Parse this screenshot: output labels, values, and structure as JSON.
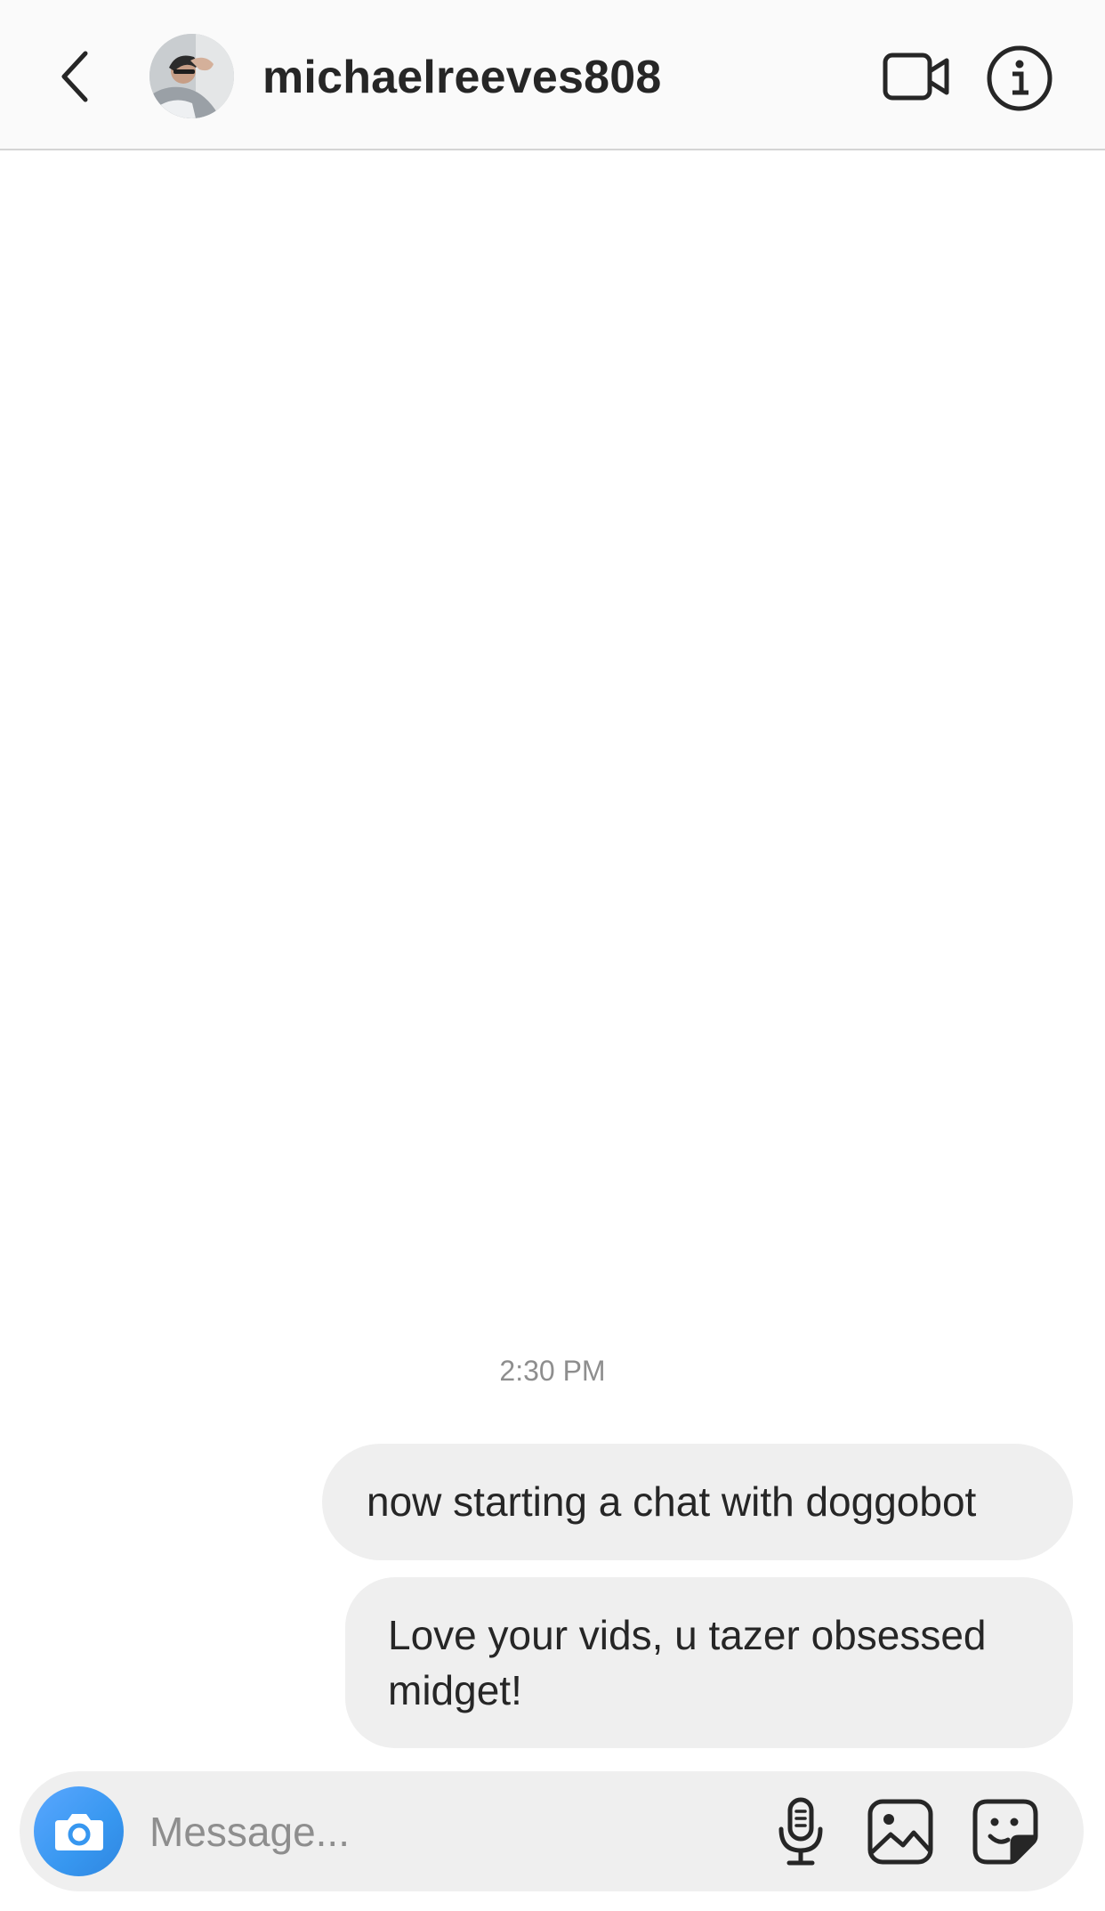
{
  "header": {
    "username": "michaelreeves808",
    "icons": {
      "back": "chevron-left-icon",
      "video": "video-camera-icon",
      "info": "info-icon"
    }
  },
  "thread": {
    "timestamp": "2:30 PM",
    "messages": [
      {
        "from": "me",
        "text": "now starting a chat with doggobot"
      },
      {
        "from": "me",
        "text": "Love your vids, u tazer obsessed midget!"
      }
    ]
  },
  "composer": {
    "placeholder": "Message...",
    "value": "",
    "icons": {
      "camera": "camera-icon",
      "mic": "microphone-icon",
      "gallery": "image-icon",
      "sticker": "sticker-icon"
    }
  },
  "colors": {
    "header_bg": "#fafafa",
    "bubble_bg": "#efefef",
    "text": "#262626",
    "muted": "#8e8e8e",
    "accent": "#3797f0"
  }
}
